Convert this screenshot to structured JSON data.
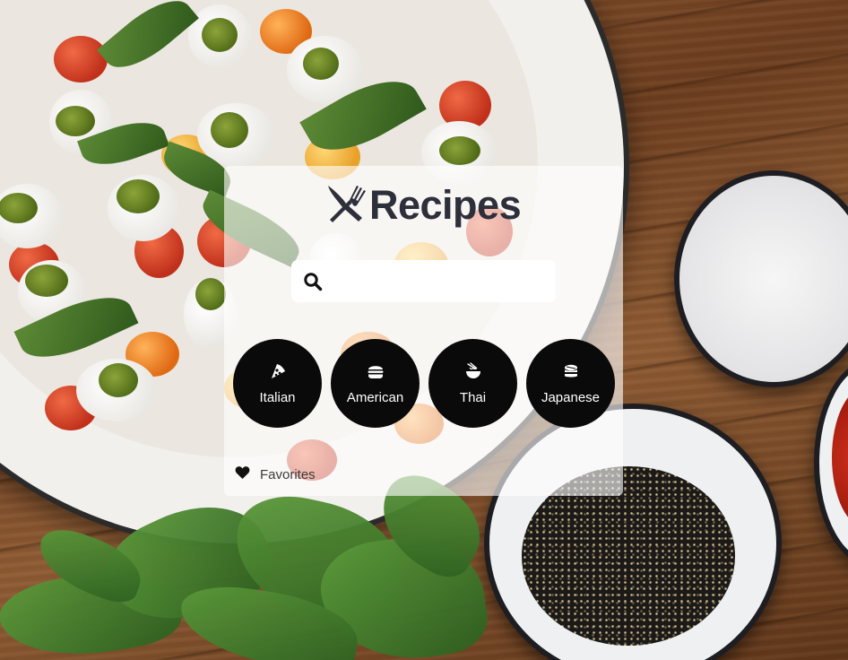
{
  "app": {
    "title": "Recipes"
  },
  "search": {
    "value": "",
    "placeholder": ""
  },
  "categories": [
    {
      "label": "Italian",
      "icon": "pizza-slice-icon"
    },
    {
      "label": "American",
      "icon": "hamburger-icon"
    },
    {
      "label": "Thai",
      "icon": "noodle-bowl-icon"
    },
    {
      "label": "Japanese",
      "icon": "sushi-icon"
    }
  ],
  "favorites": {
    "label": "Favorites",
    "icon": "heart-icon"
  },
  "colors": {
    "title": "#2d2f3a",
    "category_button": "#0a0a0a",
    "card_overlay": "rgba(255,255,255,0.62)"
  }
}
